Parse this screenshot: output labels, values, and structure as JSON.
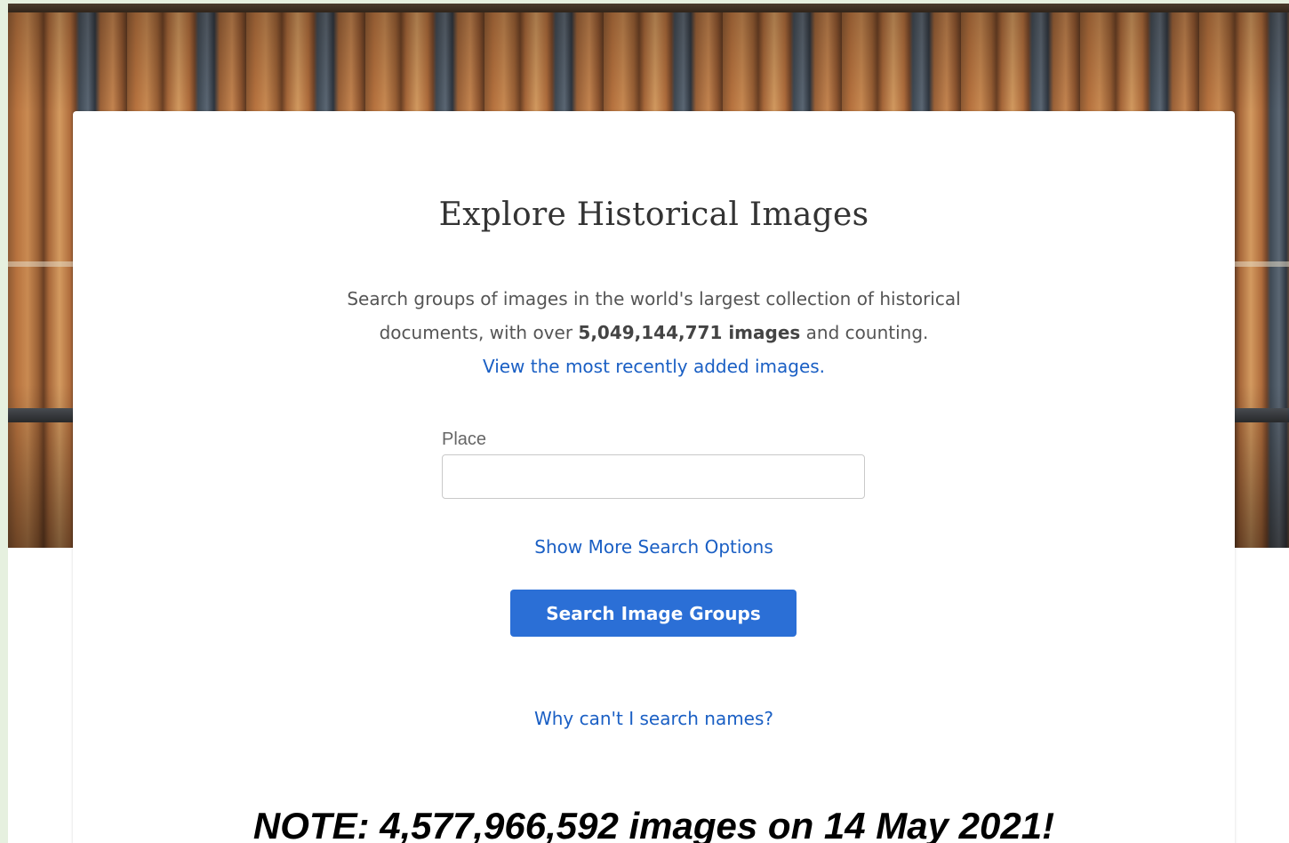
{
  "hero": {
    "image_name": "bookshelf-background"
  },
  "main": {
    "title": "Explore Historical Images",
    "description_line1": "Search groups of images in the world's largest collection of historical",
    "description_line2_prefix": "documents, with over ",
    "image_count": "5,049,144,771 images",
    "description_line2_suffix": " and counting.",
    "recent_link": "View the most recently added images.",
    "place_label": "Place",
    "place_value": "",
    "place_placeholder": "",
    "more_options_link": "Show More Search Options",
    "search_button": "Search Image Groups",
    "why_names_link": "Why can't I search names?",
    "note": "NOTE: 4,577,966,592 images on 14 May 2021!"
  },
  "colors": {
    "accent": "#2b6fd6",
    "link": "#1a5fc4",
    "page_edge": "#e6f0df"
  }
}
